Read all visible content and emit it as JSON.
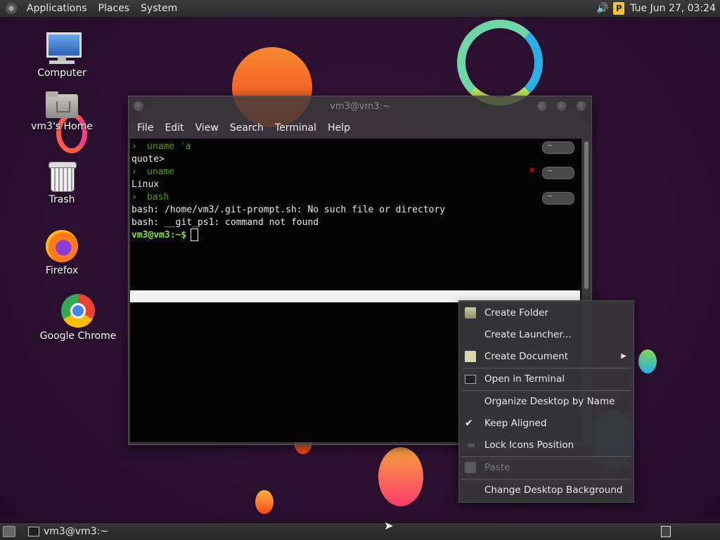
{
  "top_panel": {
    "menus": [
      "Applications",
      "Places",
      "System"
    ],
    "clock": "Tue Jun 27, 03:24",
    "tray_icons": [
      "volume-icon",
      "parking-indicator-icon"
    ]
  },
  "desktop_icons": [
    {
      "label": "Computer",
      "icon": "computer-icon"
    },
    {
      "label": "vm3's Home",
      "icon": "home-folder-icon"
    },
    {
      "label": "Trash",
      "icon": "trash-icon"
    },
    {
      "label": "Firefox",
      "icon": "firefox-icon"
    },
    {
      "label": "Google Chrome",
      "icon": "chrome-icon"
    }
  ],
  "terminal": {
    "title": "vm3@vm3:~",
    "menus": [
      "File",
      "Edit",
      "View",
      "Search",
      "Terminal",
      "Help"
    ],
    "lines": [
      "uname 'a",
      "quote>",
      "uname",
      "Linux",
      "bash",
      "bash: /home/vm3/.git-prompt.sh: No such file or directory",
      "bash: __git_ps1: command not found",
      "vm3@vm3:~$"
    ],
    "pill_label": "~"
  },
  "context_menu": {
    "items": [
      {
        "label": "Create Folder",
        "icon": "folder-new-icon"
      },
      {
        "label": "Create Launcher...",
        "icon": ""
      },
      {
        "label": "Create Document",
        "icon": "document-new-icon"
      },
      {
        "label": "Open in Terminal",
        "icon": "terminal-icon"
      },
      {
        "label": "Organize Desktop by Name",
        "icon": ""
      },
      {
        "label": "Keep Aligned",
        "icon": "checkmark-icon"
      },
      {
        "label": "Lock Icons Position",
        "icon": "lock-icon"
      },
      {
        "label": "Paste",
        "icon": "paste-icon"
      },
      {
        "label": "Change Desktop Background",
        "icon": ""
      }
    ]
  },
  "taskbar": {
    "window_label": "vm3@vm3:~"
  },
  "colors": {
    "prompt_green": "#8ae234",
    "command_green": "#4e9a06",
    "error_red": "#cc0000",
    "panel_bg": "#2f2f2f"
  }
}
